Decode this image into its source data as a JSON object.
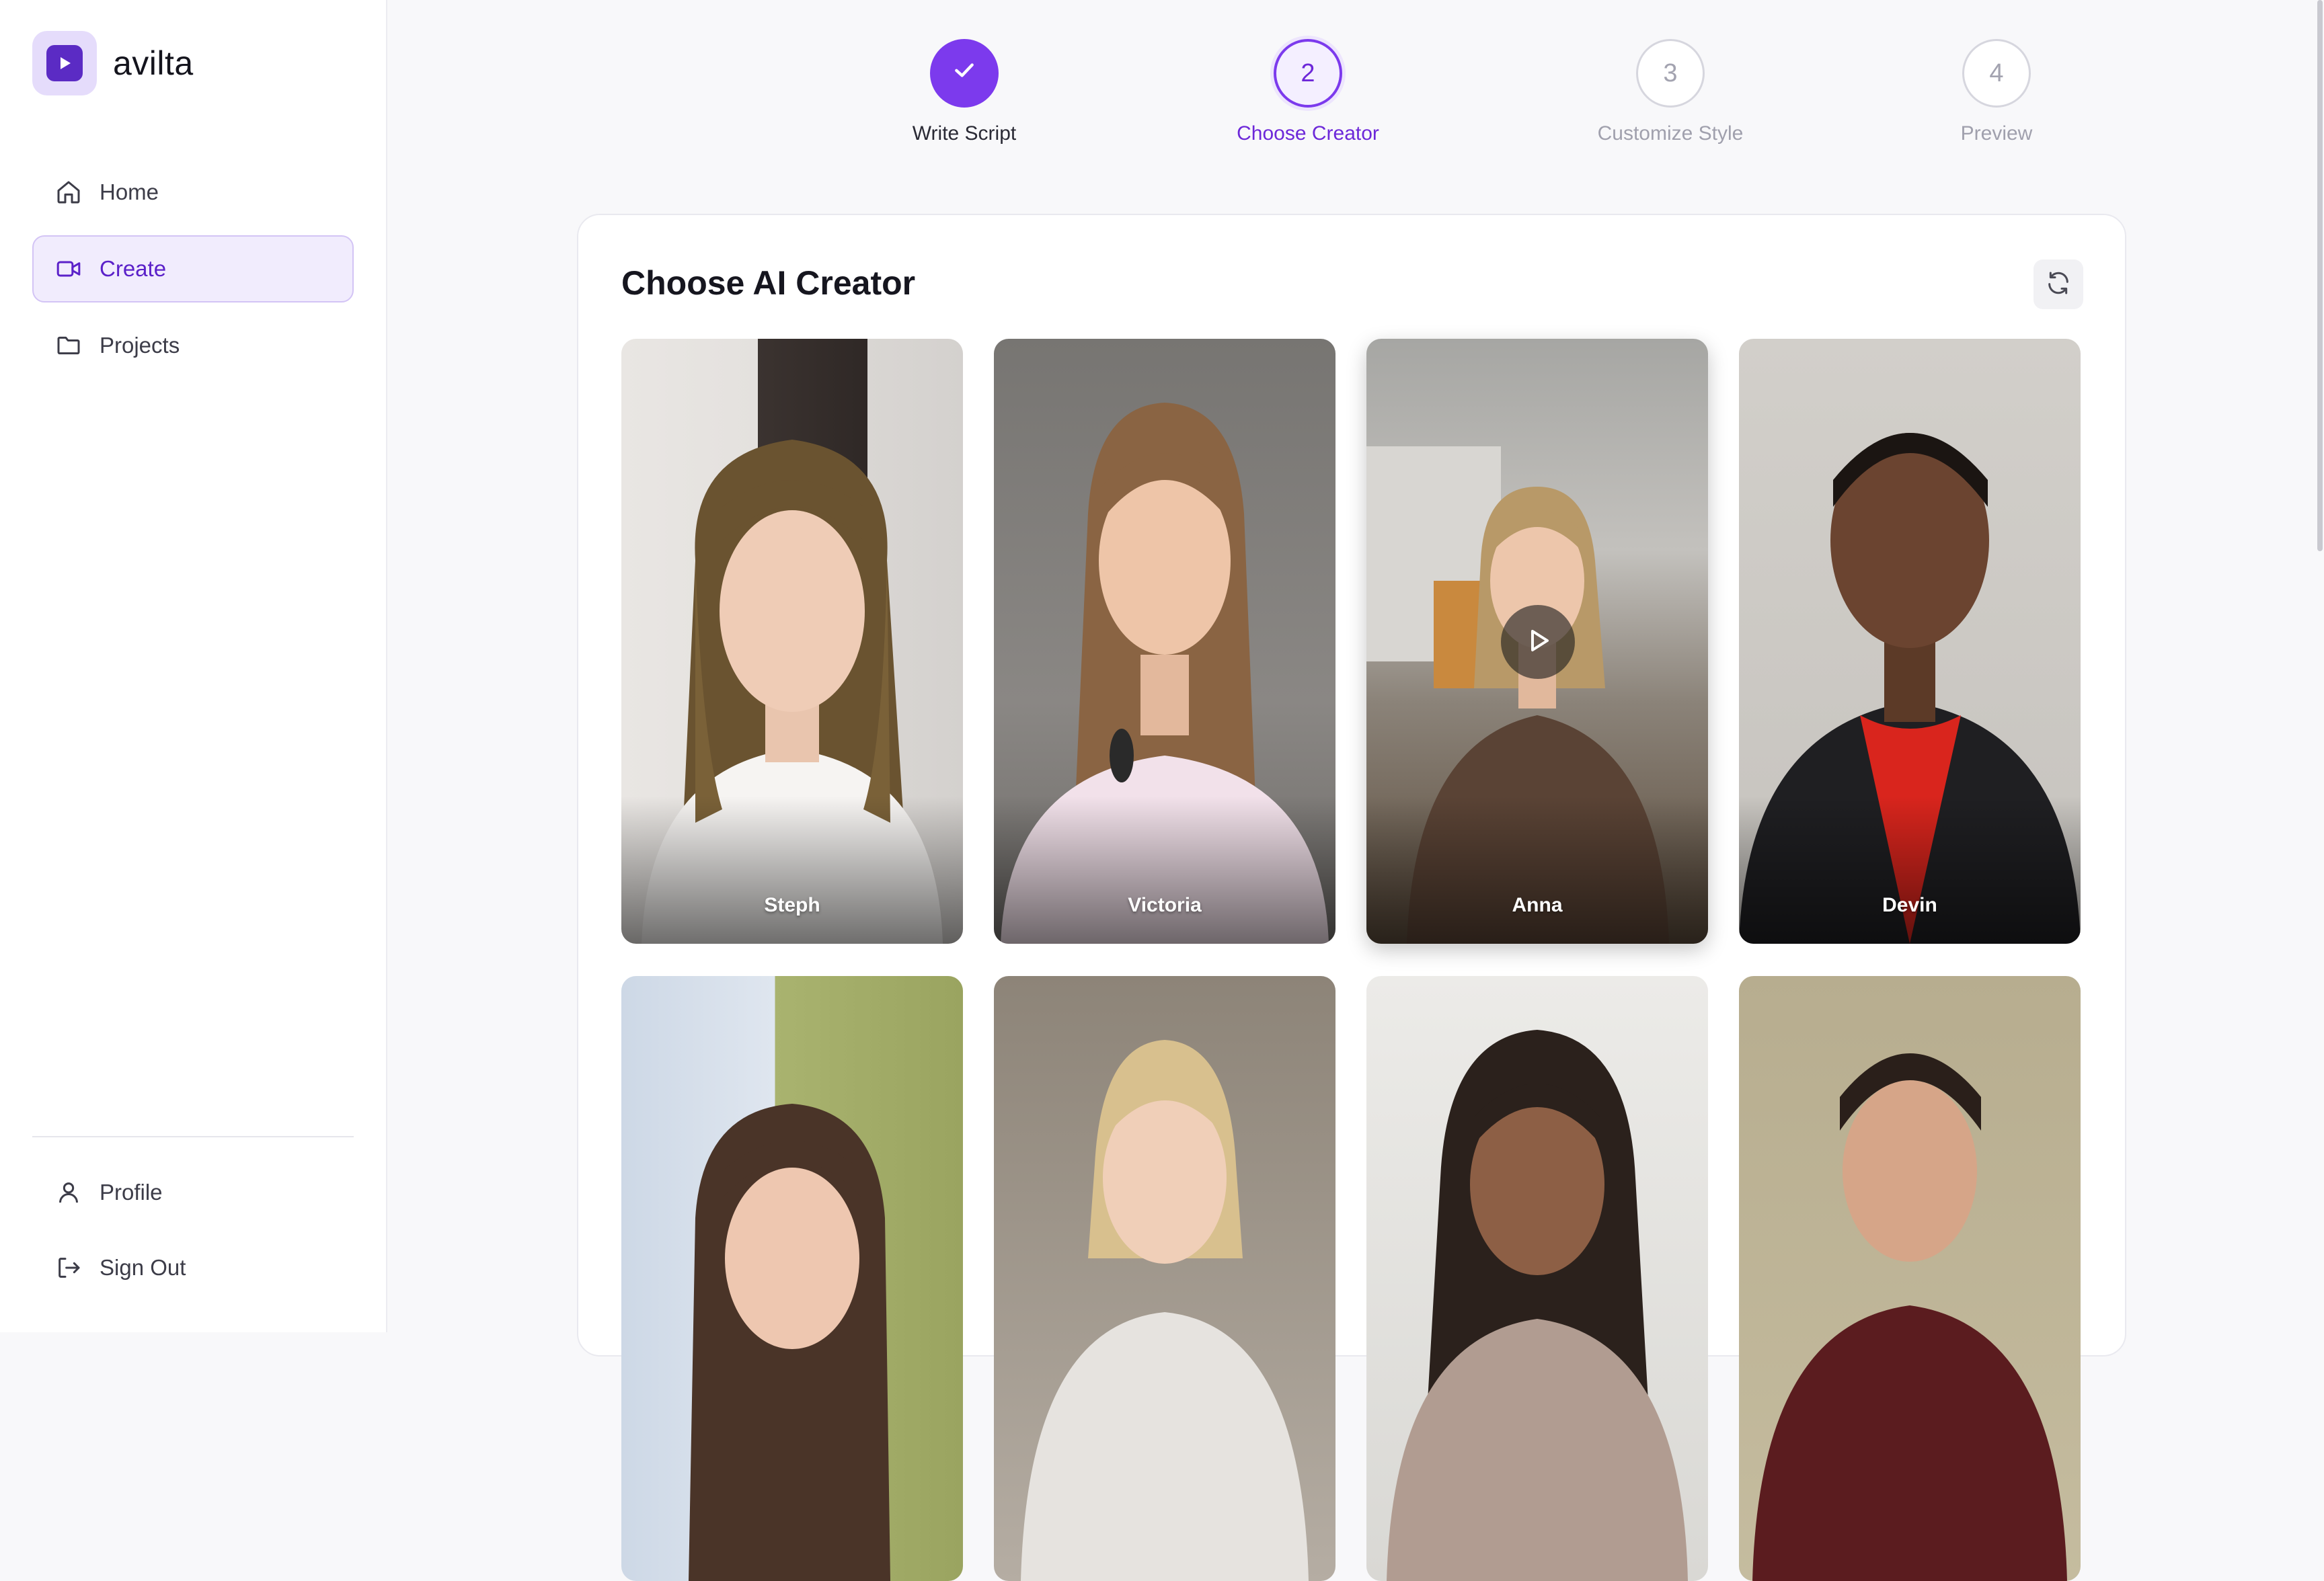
{
  "app": {
    "name": "avilta"
  },
  "sidebar": {
    "items": [
      {
        "label": "Home",
        "icon": "home-icon",
        "active": false
      },
      {
        "label": "Create",
        "icon": "video-camera-icon",
        "active": true
      },
      {
        "label": "Projects",
        "icon": "folder-icon",
        "active": false
      }
    ],
    "bottom_items": [
      {
        "label": "Profile",
        "icon": "user-icon"
      },
      {
        "label": "Sign Out",
        "icon": "sign-out-icon"
      }
    ]
  },
  "stepper": {
    "steps": [
      {
        "number": "1",
        "label": "Write Script",
        "state": "done"
      },
      {
        "number": "2",
        "label": "Choose Creator",
        "state": "current"
      },
      {
        "number": "3",
        "label": "Customize Style",
        "state": "upcoming"
      },
      {
        "number": "4",
        "label": "Preview",
        "state": "upcoming"
      }
    ]
  },
  "main": {
    "title": "Choose AI Creator",
    "refresh_icon": "refresh-icon",
    "creators": [
      {
        "name": "Steph"
      },
      {
        "name": "Victoria"
      },
      {
        "name": "Anna"
      },
      {
        "name": "Devin"
      },
      {
        "name": ""
      },
      {
        "name": ""
      },
      {
        "name": ""
      },
      {
        "name": ""
      }
    ]
  },
  "colors": {
    "accent": "#7c3aed",
    "accent_text": "#6d28d9",
    "active_nav_bg": "#f1ecfd"
  }
}
